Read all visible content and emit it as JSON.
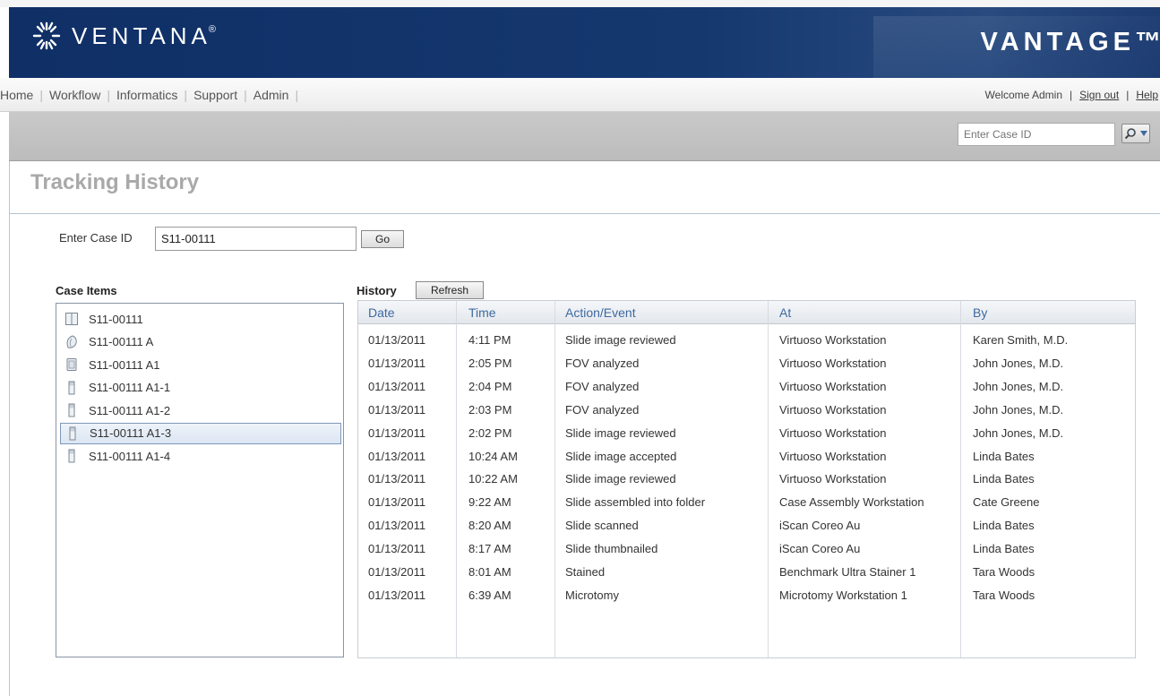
{
  "header": {
    "brand": "VENTANA",
    "brand_mark": "®",
    "product": "VANTAGE™"
  },
  "nav": {
    "items": [
      "Home",
      "Workflow",
      "Informatics",
      "Support",
      "Admin"
    ],
    "welcome": "Welcome Admin",
    "sign_out": "Sign out",
    "help": "Help"
  },
  "search": {
    "placeholder": "Enter Case ID"
  },
  "page": {
    "title": "Tracking History",
    "case_id_label": "Enter Case ID",
    "case_id_value": "S11-00111",
    "go_label": "Go",
    "case_items_label": "Case Items",
    "history_label": "History",
    "refresh_label": "Refresh"
  },
  "case_items": [
    {
      "label": "S11-00111",
      "icon": "case-icon"
    },
    {
      "label": "S11-00111 A",
      "icon": "specimen-icon"
    },
    {
      "label": "S11-00111 A1",
      "icon": "block-icon"
    },
    {
      "label": "S11-00111 A1-1",
      "icon": "slide-icon"
    },
    {
      "label": "S11-00111 A1-2",
      "icon": "slide-icon"
    },
    {
      "label": "S11-00111 A1-3",
      "icon": "slide-icon"
    },
    {
      "label": "S11-00111 A1-4",
      "icon": "slide-icon"
    }
  ],
  "selected_case_item": 5,
  "history": {
    "columns": [
      "Date",
      "Time",
      "Action/Event",
      "At",
      "By"
    ],
    "rows": [
      [
        "01/13/2011",
        "4:11 PM",
        "Slide image reviewed",
        "Virtuoso Workstation",
        "Karen Smith, M.D."
      ],
      [
        "01/13/2011",
        "2:05 PM",
        "FOV analyzed",
        "Virtuoso Workstation",
        "John Jones, M.D."
      ],
      [
        "01/13/2011",
        "2:04 PM",
        "FOV analyzed",
        "Virtuoso Workstation",
        "John Jones, M.D."
      ],
      [
        "01/13/2011",
        "2:03 PM",
        "FOV analyzed",
        "Virtuoso Workstation",
        "John Jones, M.D."
      ],
      [
        "01/13/2011",
        "2:02 PM",
        "Slide image reviewed",
        "Virtuoso Workstation",
        "John Jones, M.D."
      ],
      [
        "01/13/2011",
        "10:24 AM",
        "Slide image accepted",
        "Virtuoso Workstation",
        "Linda Bates"
      ],
      [
        "01/13/2011",
        "10:22 AM",
        "Slide image reviewed",
        "Virtuoso Workstation",
        "Linda Bates"
      ],
      [
        "01/13/2011",
        "9:22 AM",
        "Slide assembled into folder",
        "Case Assembly Workstation",
        "Cate Greene"
      ],
      [
        "01/13/2011",
        "8:20 AM",
        "Slide scanned",
        "iScan Coreo Au",
        "Linda Bates"
      ],
      [
        "01/13/2011",
        "8:17 AM",
        "Slide thumbnailed",
        "iScan Coreo Au",
        "Linda Bates"
      ],
      [
        "01/13/2011",
        "8:01 AM",
        "Stained",
        "Benchmark Ultra Stainer 1",
        "Tara Woods"
      ],
      [
        "01/13/2011",
        "6:39 AM",
        "Microtomy",
        "Microtomy Workstation 1",
        "Tara Woods"
      ]
    ]
  },
  "colors": {
    "header_bg": "#15386f",
    "link": "#3d6aa0",
    "title": "#a9a9a9"
  }
}
